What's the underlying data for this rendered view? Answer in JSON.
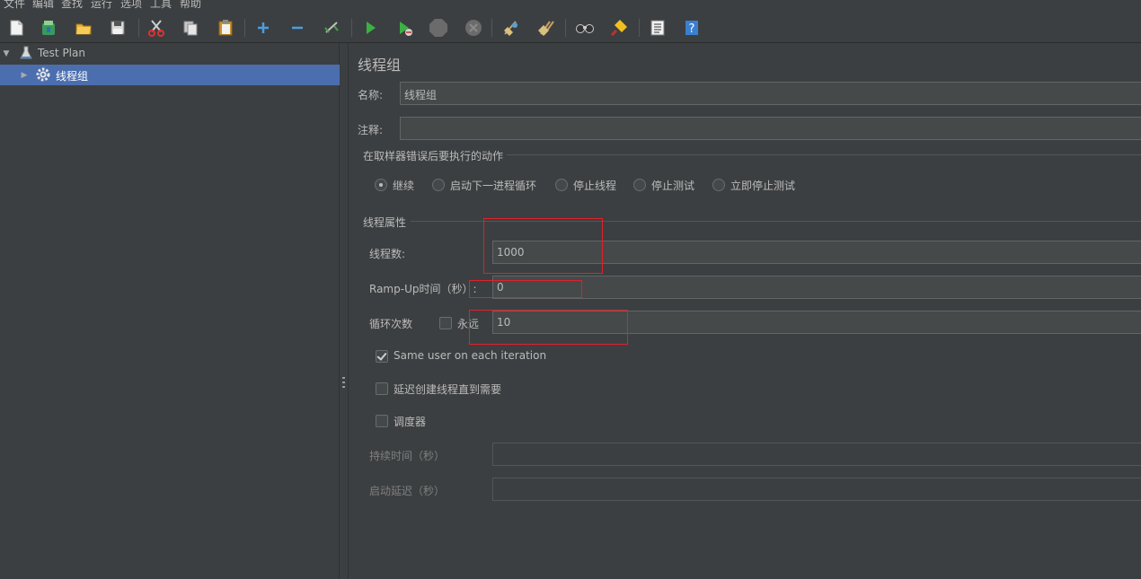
{
  "menu": [
    "文件",
    "编辑",
    "查找",
    "运行",
    "选项",
    "工具",
    "帮助"
  ],
  "toolbar": {
    "icons": [
      "new-icon",
      "templates-icon",
      "open-icon",
      "save-icon",
      "cut-icon",
      "copy-icon",
      "paste-icon",
      "expand-icon",
      "collapse-icon",
      "toggle-icon",
      "start-icon",
      "start-no-pauses-icon",
      "stop-icon",
      "shutdown-icon",
      "clear-icon",
      "clear-all-icon",
      "search-icon",
      "reset-search-icon",
      "function-helper-icon",
      "help-icon"
    ]
  },
  "tree": {
    "items": [
      {
        "label": "Test Plan",
        "icon": "test-plan-icon",
        "expanded": true,
        "selected": false
      },
      {
        "label": "线程组",
        "icon": "gear-icon",
        "expanded": false,
        "selected": true
      }
    ]
  },
  "panel": {
    "title": "线程组",
    "name_label": "名称:",
    "name_value": "线程组",
    "comment_label": "注释:",
    "comment_value": "",
    "error_action": {
      "legend": "在取样器错误后要执行的动作",
      "options": [
        "继续",
        "启动下一进程循环",
        "停止线程",
        "停止测试",
        "立即停止测试"
      ],
      "selected": "继续"
    },
    "thread_props": {
      "legend": "线程属性",
      "threads_label": "线程数:",
      "threads_value": "1000",
      "rampup_label": "Ramp-Up时间（秒）:",
      "rampup_value": "0",
      "loop_label": "循环次数",
      "forever_label": "永远",
      "forever_checked": false,
      "loop_value": "10",
      "same_user_label": "Same user on each iteration",
      "same_user_checked": true,
      "delay_label": "延迟创建线程直到需要",
      "delay_checked": false,
      "scheduler_label": "调度器",
      "scheduler_checked": false,
      "duration_label": "持续时间（秒）",
      "duration_value": "",
      "startup_delay_label": "启动延迟（秒）",
      "startup_delay_value": ""
    }
  },
  "colors": {
    "background": "#3c3f41",
    "selection": "#4b6eaf",
    "highlight": "#e0212b"
  }
}
